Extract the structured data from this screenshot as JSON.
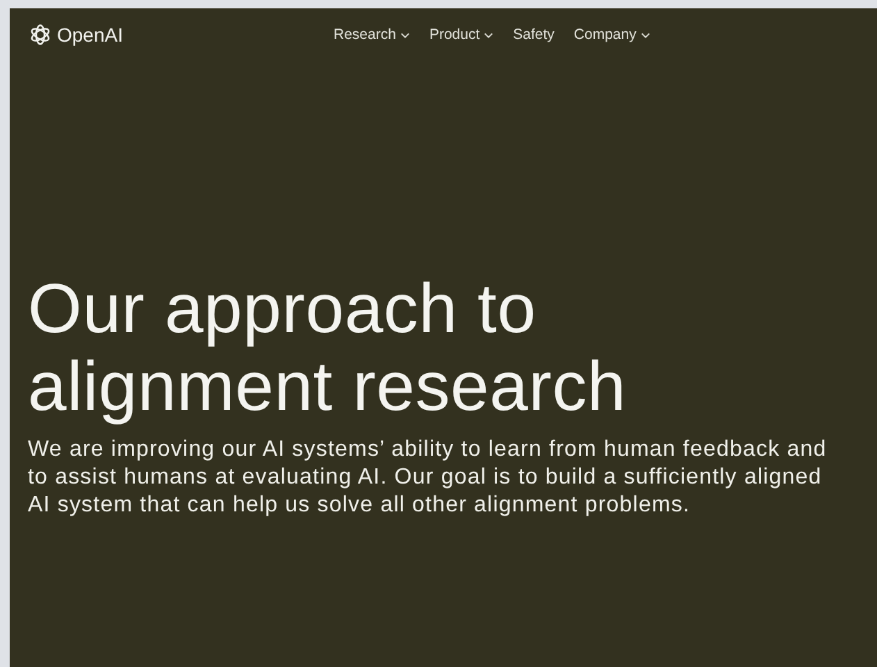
{
  "header": {
    "logo": "OpenAI",
    "nav": [
      {
        "label": "Research",
        "has_menu": true
      },
      {
        "label": "Product",
        "has_menu": true
      },
      {
        "label": "Safety",
        "has_menu": false
      },
      {
        "label": "Company",
        "has_menu": true
      }
    ]
  },
  "hero": {
    "title": "Our approach to alignment research",
    "text": "We are improving our AI systems’ ability to learn from human feedback and to assist humans at evaluating AI. Our goal is to build a sufficiently aligned AI system that can help us solve all other alignment problems."
  }
}
